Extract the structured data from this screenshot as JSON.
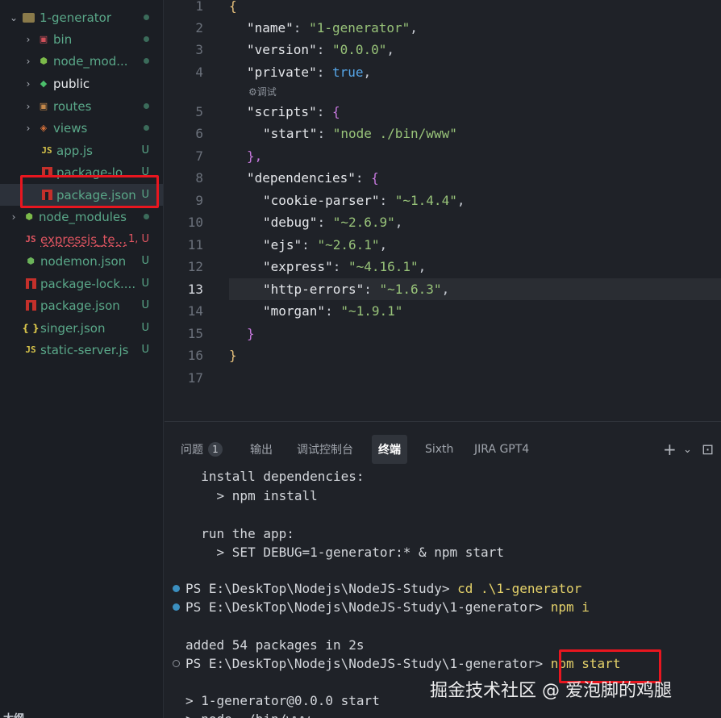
{
  "sidebar": {
    "items": [
      {
        "label": "1-generator",
        "status": "",
        "depth": 0
      },
      {
        "label": "bin",
        "status": ""
      },
      {
        "label": "node_mod...",
        "status": ""
      },
      {
        "label": "public",
        "status": ""
      },
      {
        "label": "routes",
        "status": ""
      },
      {
        "label": "views",
        "status": ""
      },
      {
        "label": "app.js",
        "status": "U",
        "icon": "JS"
      },
      {
        "label": "package-lo...",
        "status": "U"
      },
      {
        "label": "package.json",
        "status": "U"
      },
      {
        "label": "node_modules",
        "status": ""
      },
      {
        "label": "expressjs_te...",
        "status": "1, U",
        "icon": "JS"
      },
      {
        "label": "nodemon.json",
        "status": "U"
      },
      {
        "label": "package-lock....",
        "status": "U"
      },
      {
        "label": "package.json",
        "status": "U"
      },
      {
        "label": "singer.json",
        "status": "U",
        "icon": "{ }"
      },
      {
        "label": "static-server.js",
        "status": "U",
        "icon": "JS"
      }
    ],
    "bottom_label": "大纲"
  },
  "editor": {
    "codelens": "调试",
    "lines": [
      {
        "n": "1",
        "code": "{"
      },
      {
        "n": "2",
        "key": "\"name\"",
        "val": "\"1-generator\"",
        "tail": ","
      },
      {
        "n": "3",
        "key": "\"version\"",
        "val": "\"0.0.0\"",
        "tail": ","
      },
      {
        "n": "4",
        "key": "\"private\"",
        "val": "true",
        "tail": ","
      },
      {
        "n": "5",
        "key": "\"scripts\"",
        "val": "{",
        "tail": ""
      },
      {
        "n": "6",
        "key": "\"start\"",
        "val": "\"node ./bin/www\"",
        "tail": ""
      },
      {
        "n": "7",
        "code": "},"
      },
      {
        "n": "8",
        "key": "\"dependencies\"",
        "val": "{",
        "tail": ""
      },
      {
        "n": "9",
        "key": "\"cookie-parser\"",
        "val": "\"~1.4.4\"",
        "tail": ","
      },
      {
        "n": "10",
        "key": "\"debug\"",
        "val": "\"~2.6.9\"",
        "tail": ","
      },
      {
        "n": "11",
        "key": "\"ejs\"",
        "val": "\"~2.6.1\"",
        "tail": ","
      },
      {
        "n": "12",
        "key": "\"express\"",
        "val": "\"~4.16.1\"",
        "tail": ","
      },
      {
        "n": "13",
        "key": "\"http-errors\"",
        "val": "\"~1.6.3\"",
        "tail": ","
      },
      {
        "n": "14",
        "key": "\"morgan\"",
        "val": "\"~1.9.1\"",
        "tail": ""
      },
      {
        "n": "15",
        "code": "}"
      },
      {
        "n": "16",
        "code": "}"
      },
      {
        "n": "17",
        "code": ""
      }
    ]
  },
  "panel": {
    "tabs": [
      {
        "label": "问题",
        "badge": "1"
      },
      {
        "label": "输出"
      },
      {
        "label": "调试控制台"
      },
      {
        "label": "终端"
      },
      {
        "label": "Sixth"
      },
      {
        "label": "JIRA GPT4"
      }
    ],
    "actions": {
      "add": "+",
      "dropdown": "⌄",
      "terminal": "⊡"
    },
    "terminal": {
      "install_header": "  install dependencies:",
      "install_cmd": "    > npm install",
      "run_header": "  run the app:",
      "run_cmd": "    > SET DEBUG=1-generator:* & npm start",
      "prompt1_path": "PS E:\\DeskTop\\Nodejs\\NodeJS-Study> ",
      "prompt1_cmd": "cd .\\1-generator",
      "prompt2_path": "PS E:\\DeskTop\\Nodejs\\NodeJS-Study\\1-generator> ",
      "prompt2_cmd": "npm i",
      "added": "added 54 packages in 2s",
      "prompt3_path": "PS E:\\DeskTop\\Nodejs\\NodeJS-Study\\1-generator> ",
      "prompt3_cmd": "npm start",
      "out1": "> 1-generator@0.0.0 start",
      "out2": "> node ./bin/www"
    }
  },
  "watermark": "掘金技术社区 @ 爱泡脚的鸡腿",
  "colors": {
    "accent_red": "#e8161f",
    "string": "#98c379",
    "keyword": "#56a6e8"
  }
}
